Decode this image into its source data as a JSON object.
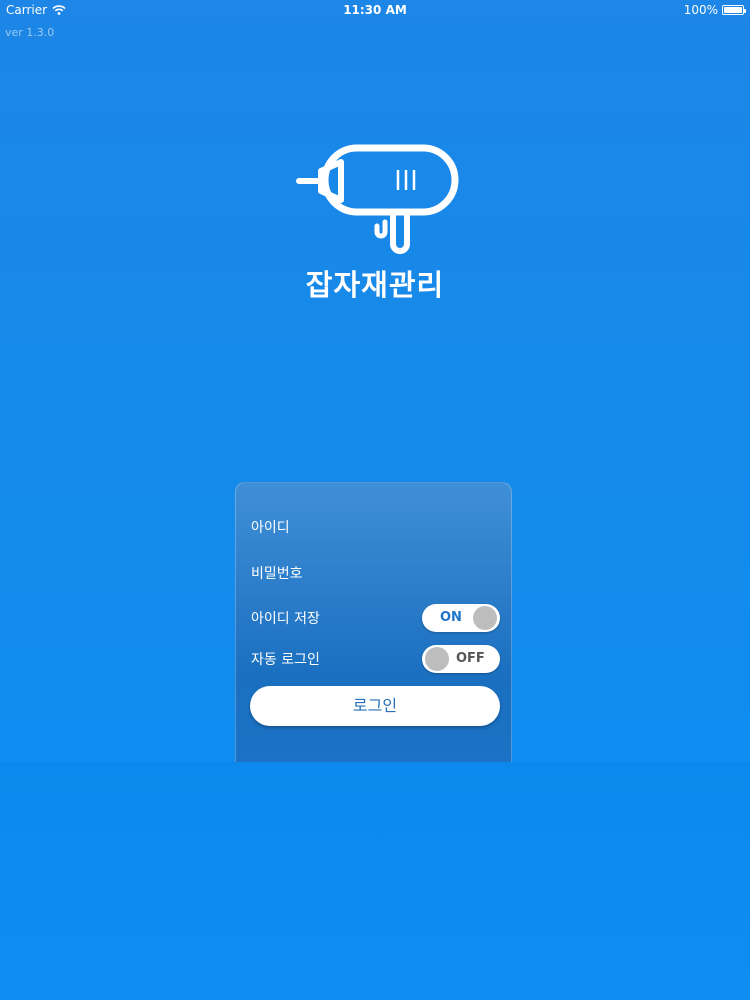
{
  "status_bar": {
    "carrier": "Carrier",
    "time": "11:30 AM",
    "battery": "100%"
  },
  "version": "ver 1.3.0",
  "app": {
    "title": "잡자재관리",
    "logo_icon": "drill-icon"
  },
  "login": {
    "id_label": "아이디",
    "password_label": "비밀번호",
    "save_id_label": "아이디 저장",
    "save_id_toggle": "ON",
    "auto_login_label": "자동 로그인",
    "auto_login_toggle": "OFF",
    "login_button": "로그인"
  },
  "colors": {
    "background": "#158aea",
    "card": "#2e7fcb",
    "toggle_on_text": "#1d74c9",
    "button_text": "#2a6fb8"
  }
}
